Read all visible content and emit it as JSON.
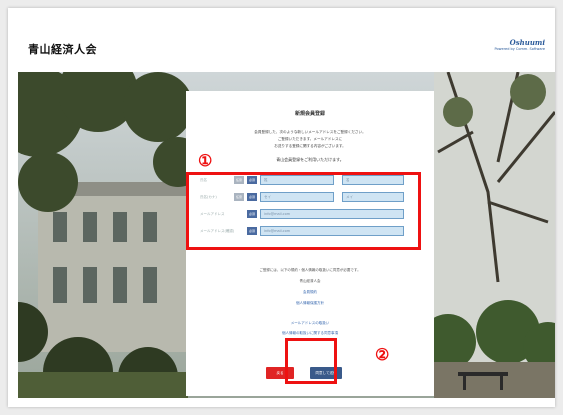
{
  "header": {
    "site_title": "青山経済人会",
    "brand_main": "Oshuumi",
    "brand_sub": "Powered by Comm. Software"
  },
  "form": {
    "title": "新規会員登録",
    "intro": [
      "会員登録した、次のような新しいメールアドレスをご登録ください。",
      "ご登録いただきます。メールアドレスに",
      "お送りする登録に関する内容がございます。"
    ],
    "notice": "青山会員登録をご利用いただけます。",
    "fields": [
      {
        "label": "氏名",
        "badge": "必須",
        "has_optional": true,
        "value_left": "姓",
        "value_right": "名"
      },
      {
        "label": "氏名(カナ)",
        "badge": "必須",
        "has_optional": true,
        "value_left": "セイ",
        "value_right": "メイ"
      },
      {
        "label": "メールアドレス",
        "badge": "必須",
        "has_optional": false,
        "value": "info@mail.com"
      },
      {
        "label": "メールアドレス(確認)",
        "badge": "必須",
        "has_optional": false,
        "value": "info@mail.com"
      }
    ],
    "optional_badge": "任意",
    "consent": "ご登録には、以下の規約・個人情報の取扱いに同意が必要です。",
    "links": {
      "terms_heading": "青山経済人会",
      "terms": "会員規約",
      "privacy": "個人情報保護方針",
      "email_policy": "メールアドレスの取扱い",
      "cookie_policy": "個人情報の取扱いに関する同意事項"
    },
    "buttons": {
      "back": "戻る",
      "submit": "同意して送信"
    }
  },
  "annotations": {
    "one": "①",
    "two": "②",
    "color": "#ee1111"
  }
}
